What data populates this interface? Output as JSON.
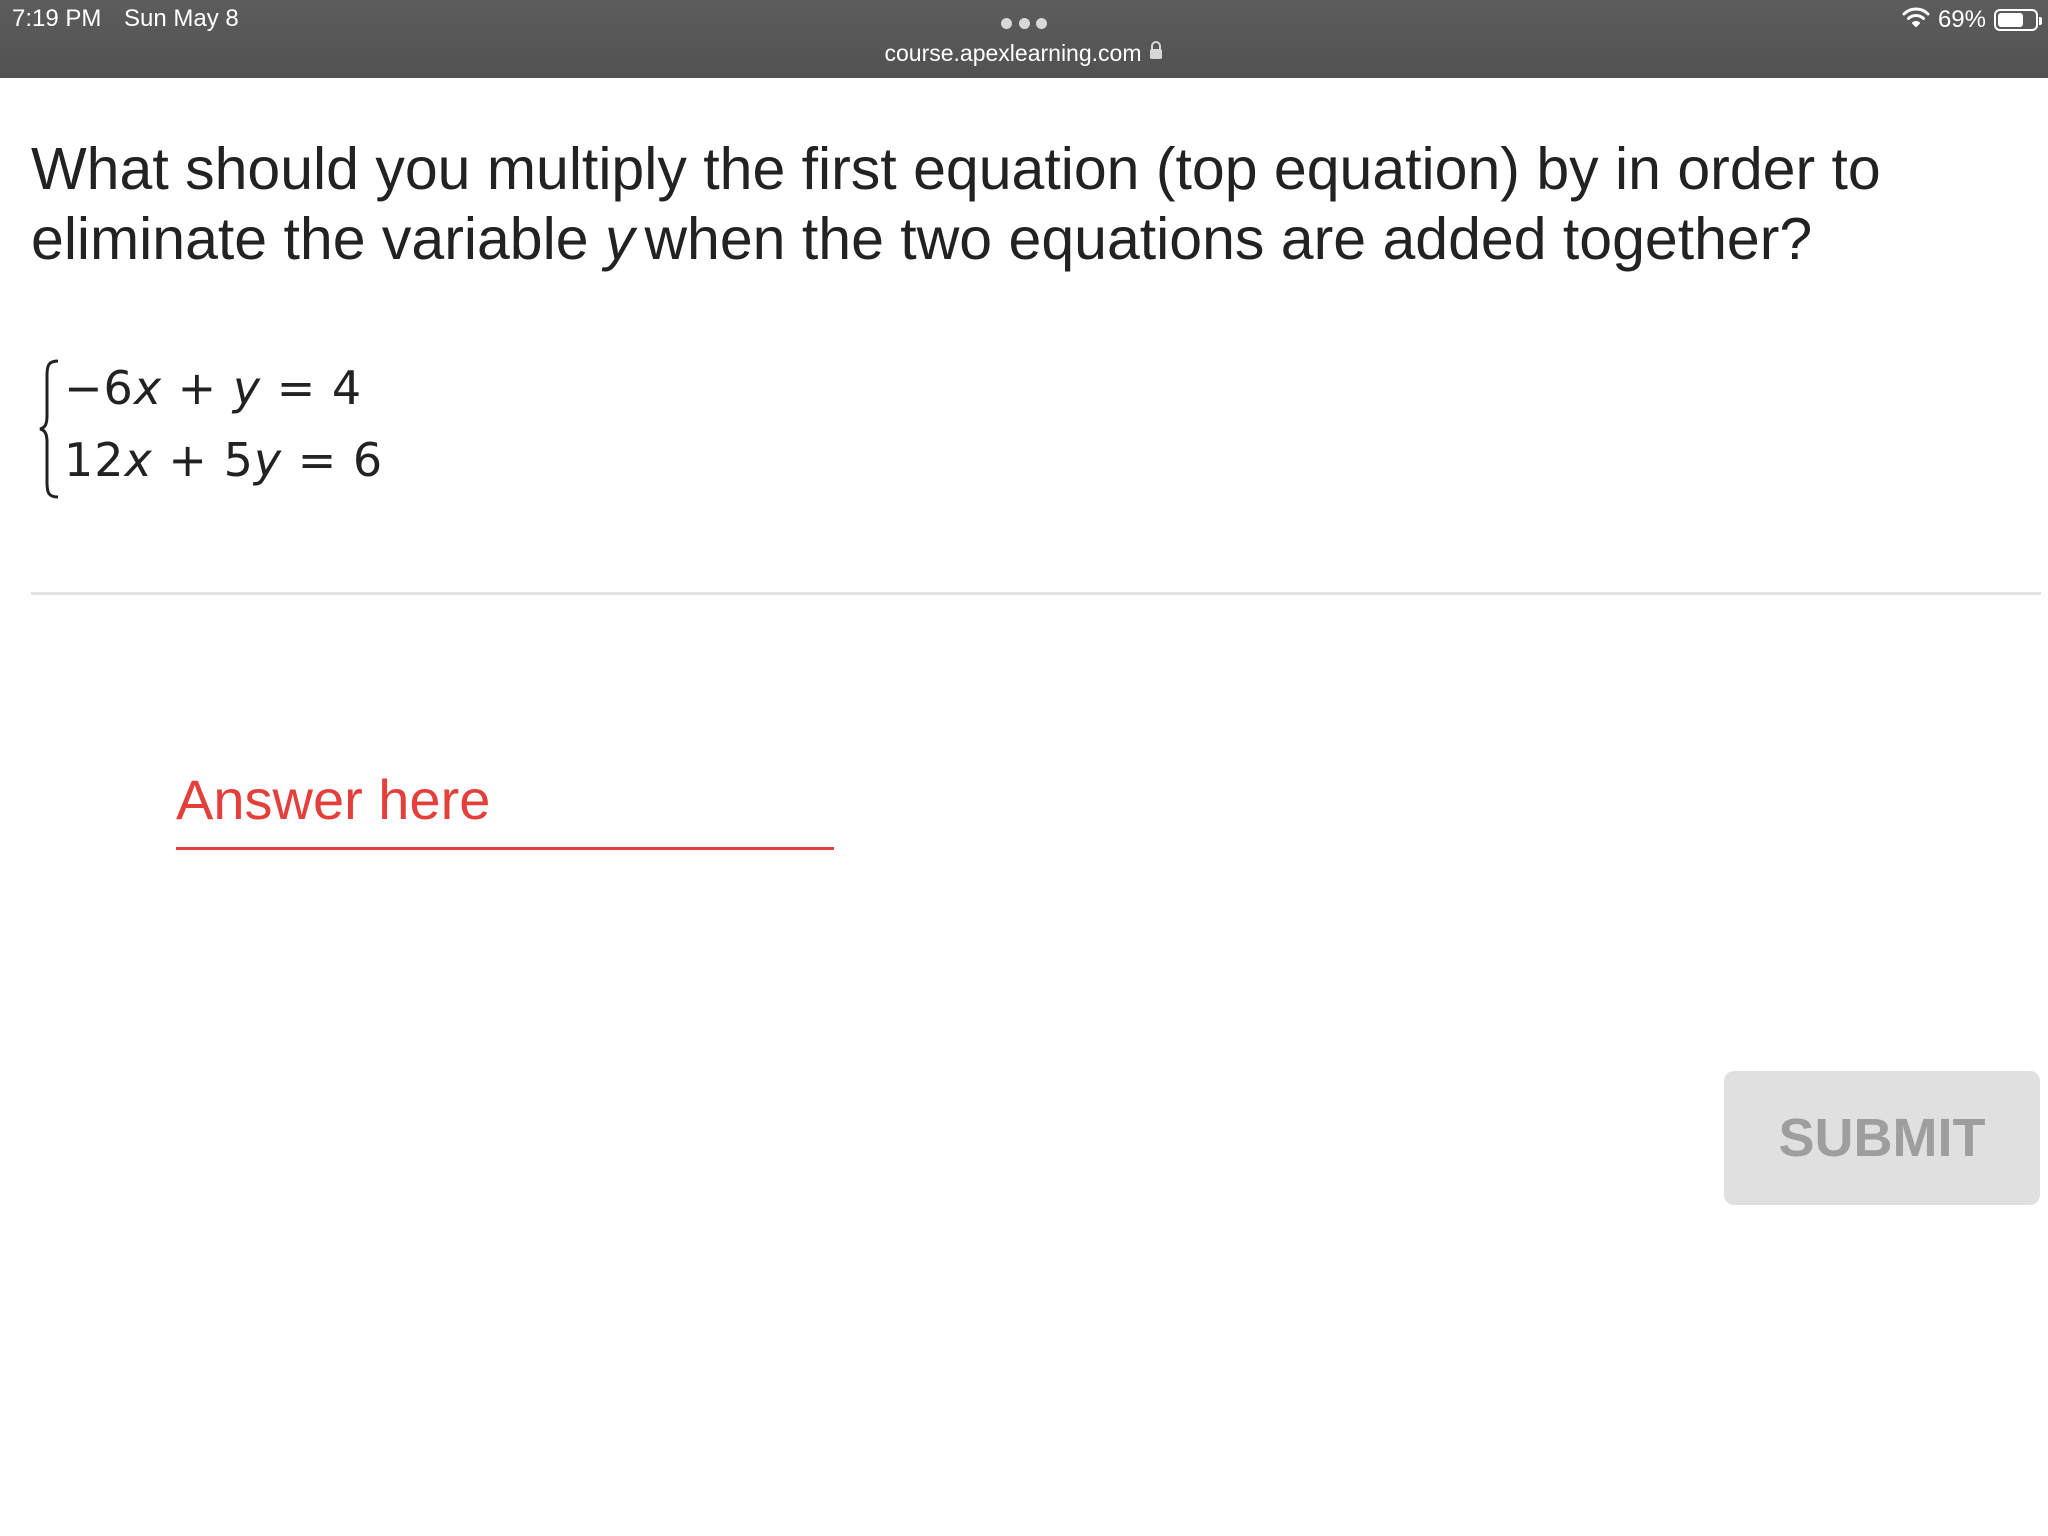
{
  "status_bar": {
    "time": "7:19 PM",
    "date": "Sun May 8",
    "battery_percent": "69%",
    "battery_level": 0.69,
    "url": "course.apexlearning.com"
  },
  "question": {
    "text_before": "What should you multiply the first equation (top equation) by in order to eliminate the variable",
    "variable": "y",
    "text_after": "when the two equations are added together?"
  },
  "system": {
    "eq1": {
      "a": "−6",
      "x": "x",
      "op": " + ",
      "y": "y",
      "rhs": " = 4"
    },
    "eq2": {
      "a": "12",
      "x": "x",
      "op": " + ",
      "b": "5",
      "y": "y",
      "rhs": " = 6"
    }
  },
  "answer": {
    "placeholder": "Answer here",
    "value": ""
  },
  "submit": {
    "label": "SUBMIT"
  },
  "colors": {
    "accent": "#e43f3a",
    "status_bar": "#575757",
    "submit_disabled_bg": "#e0e0e0",
    "submit_disabled_text": "#9e9e9e"
  }
}
